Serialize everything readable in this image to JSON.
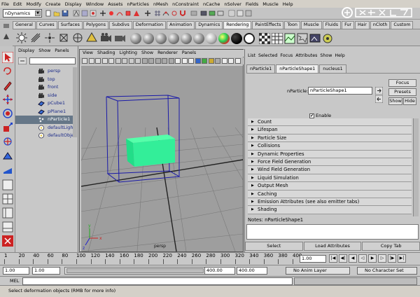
{
  "menubar": [
    "File",
    "Edit",
    "Modify",
    "Create",
    "Display",
    "Window",
    "Assets",
    "nParticles",
    "nMesh",
    "nConstraint",
    "nCache",
    "nSolver",
    "Fields",
    "Muscle",
    "Help"
  ],
  "statusline": {
    "mode": "nDynamics"
  },
  "shelf": {
    "tabs": [
      "General",
      "Curves",
      "Surfaces",
      "Polygons",
      "Subdivs",
      "Deformation",
      "Animation",
      "Dynamics",
      "Rendering",
      "PaintEffects",
      "Toon",
      "Muscle",
      "Fluids",
      "Fur",
      "Hair",
      "nCloth",
      "Custom"
    ],
    "active_tab": "Rendering"
  },
  "outliner": {
    "menu": [
      "Display",
      "Show",
      "Panels"
    ],
    "items": [
      {
        "label": "persp",
        "icon": "camera-icon"
      },
      {
        "label": "top",
        "icon": "camera-icon"
      },
      {
        "label": "front",
        "icon": "camera-icon"
      },
      {
        "label": "side",
        "icon": "camera-icon"
      },
      {
        "label": "pCube1",
        "icon": "mesh-icon"
      },
      {
        "label": "pPlane1",
        "icon": "mesh-icon"
      },
      {
        "label": "nParticle1",
        "icon": "particle-icon"
      },
      {
        "label": "defaultLightSet",
        "icon": "set-icon"
      },
      {
        "label": "defaultObjectSet",
        "icon": "set-icon"
      }
    ],
    "selected_index": 6
  },
  "viewport": {
    "menu": [
      "View",
      "Shading",
      "Lighting",
      "Show",
      "Renderer",
      "Panels"
    ],
    "camera_label": "persp",
    "axis": {
      "x": "x",
      "y": "y",
      "z": "z"
    },
    "particle_color": "#33ee99"
  },
  "attribute_editor": {
    "menu": [
      "List",
      "Selected",
      "Focus",
      "Attributes",
      "Show",
      "Help"
    ],
    "tabs": [
      "nParticle1",
      "nParticleShape1",
      "nucleus1"
    ],
    "active_tab": "nParticleShape1",
    "node_label": "nParticle:",
    "node_value": "nParticleShape1",
    "buttons": {
      "focus": "Focus",
      "presets": "Presets",
      "show": "Show",
      "hide": "Hide"
    },
    "enable_label": "Enable",
    "enable_checked": true,
    "check_mark": "✔",
    "sections": [
      "Count",
      "Lifespan",
      "Particle Size",
      "Collisions",
      "Dynamic Properties",
      "Force Field Generation",
      "Wind Field Generation",
      "Liquid Simulation",
      "Output Mesh",
      "Caching",
      "Emission Attributes (see also emitter tabs)",
      "Shading"
    ],
    "notes_label": "Notes:  nParticleShape1",
    "bottom_buttons": [
      "Select",
      "Load Attributes",
      "Copy Tab"
    ]
  },
  "timeslider": {
    "ticks": [
      "1",
      "20",
      "40",
      "60",
      "80",
      "100",
      "120",
      "140",
      "160",
      "180",
      "200",
      "220",
      "240",
      "260",
      "280",
      "300",
      "320",
      "340",
      "360",
      "380",
      "400"
    ],
    "current_time": "1.00"
  },
  "rangeslider": {
    "start": "1.00",
    "playback_start": "1.00",
    "playback_end": "400.00",
    "end": "400.00",
    "anim_layer": "No Anim Layer",
    "character_set": "No Character Set"
  },
  "cmdline": {
    "label": "MEL"
  },
  "helpline": {
    "text": "Select deformation objects (RMB for more info)"
  }
}
